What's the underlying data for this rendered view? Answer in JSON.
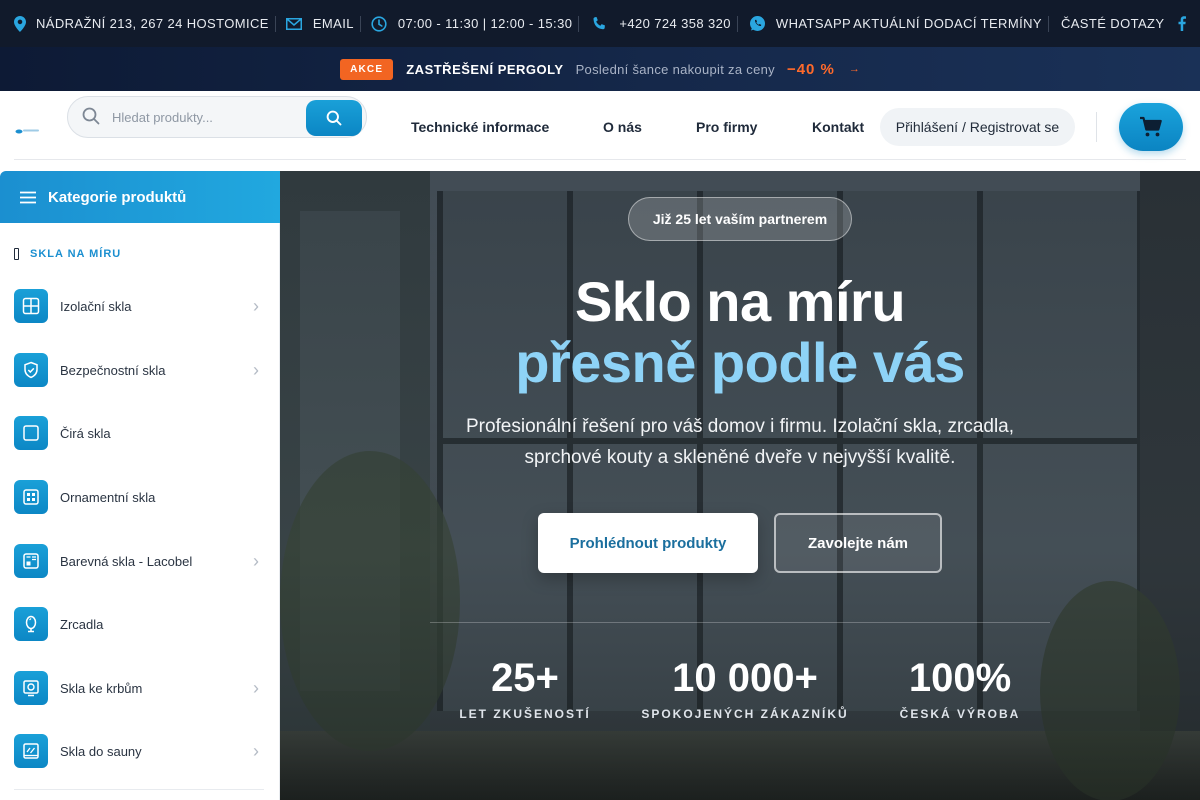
{
  "topbar": {
    "address": "NÁDRAŽNÍ 213, 267 24 HOSTOMICE",
    "email": "EMAIL",
    "hours": "07:00 - 11:30 | 12:00 - 15:30",
    "phone": "+420 724 358 320",
    "whatsapp": "WHATSAPP",
    "delivery": "AKTUÁLNÍ DODACÍ TERMÍNY",
    "faq": "ČASTÉ DOTAZY"
  },
  "promo": {
    "badge": "AKCE",
    "title": "ZASTŘEŠENÍ PERGOLY",
    "subtitle": "Poslední šance nakoupit za ceny",
    "discount": "−40 %",
    "arrow": "→"
  },
  "header": {
    "search_placeholder": "Hledat produkty...",
    "nav": [
      "Technické informace",
      "O nás",
      "Pro firmy",
      "Kontakt"
    ],
    "login": "Přihlášení / Registrovat se"
  },
  "sidebar": {
    "title": "Kategorie produktů",
    "section": "SKLA NA MÍRU",
    "items": [
      {
        "label": "Izolační skla",
        "icon": "window-icon",
        "chevron": "›"
      },
      {
        "label": "Bezpečnostní skla",
        "icon": "shield-icon",
        "chevron": "›"
      },
      {
        "label": "Čirá skla",
        "icon": "square-icon",
        "chevron": ""
      },
      {
        "label": "Ornamentní skla",
        "icon": "ornament-icon",
        "chevron": ""
      },
      {
        "label": "Barevná skla - Lacobel",
        "icon": "palette-icon",
        "chevron": "›"
      },
      {
        "label": "Zrcadla",
        "icon": "mirror-icon",
        "chevron": ""
      },
      {
        "label": "Skla ke krbům",
        "icon": "fireplace-icon",
        "chevron": "›"
      },
      {
        "label": "Skla do sauny",
        "icon": "sauna-icon",
        "chevron": "›"
      }
    ]
  },
  "hero": {
    "badge": "Již 25 let vaším partnerem",
    "title_line1": "Sklo na míru",
    "title_line2": "přesně podle vás",
    "description": "Profesionální řešení pro váš domov i firmu. Izolační skla, zrcadla, sprchové kouty a skleněné dveře v nejvyšší kvalitě.",
    "primary_cta": "Prohlédnout produkty",
    "secondary_cta": "Zavolejte nám",
    "stats": [
      {
        "value": "25+",
        "label": "LET ZKUŠENOSTÍ"
      },
      {
        "value": "10 000+",
        "label": "SPOKOJENÝCH ZÁKAZNÍKŮ"
      },
      {
        "value": "100%",
        "label": "ČESKÁ VÝROBA"
      }
    ]
  },
  "colors": {
    "accent": "#1b8fd0",
    "hero_highlight": "#8ed3f7",
    "promo_orange": "#f26522",
    "topbar_bg": "#111a2b"
  }
}
